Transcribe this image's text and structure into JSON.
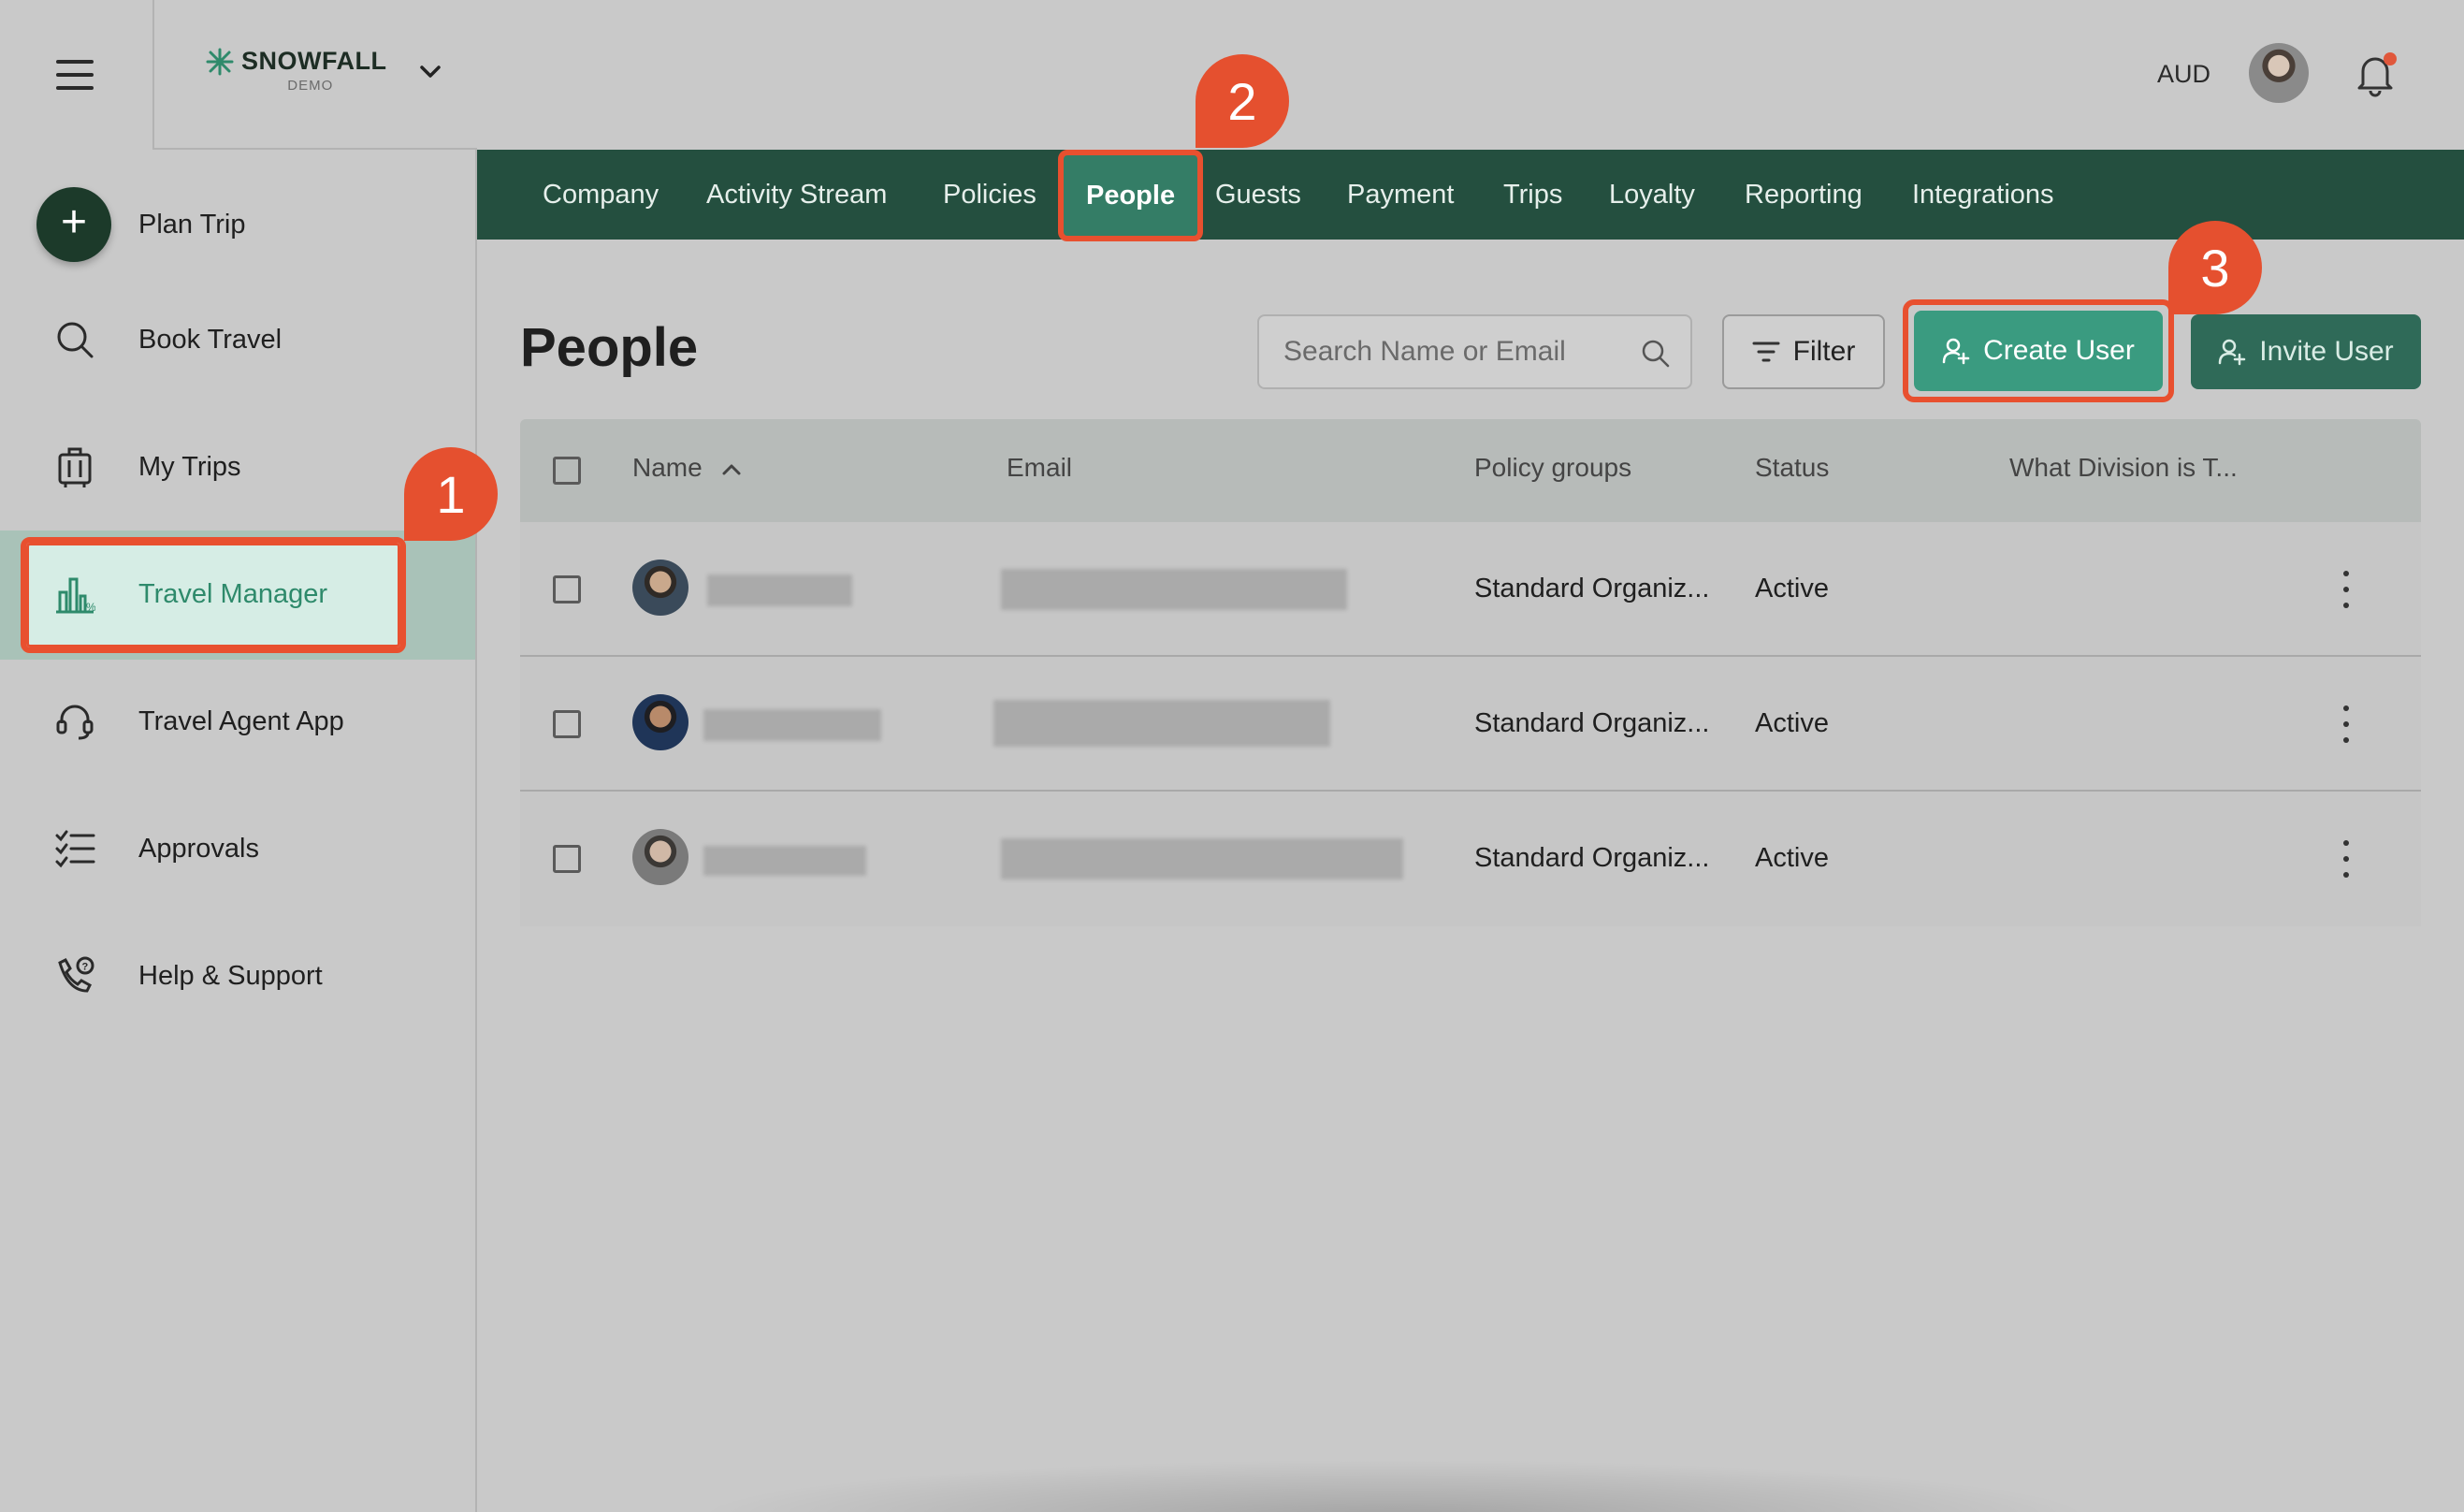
{
  "brand": {
    "name": "SNOWFALL",
    "sub": "DEMO"
  },
  "header": {
    "currency": "AUD"
  },
  "sidebar": {
    "items": [
      {
        "label": "Plan Trip",
        "icon": "plus-icon"
      },
      {
        "label": "Book Travel",
        "icon": "search-icon"
      },
      {
        "label": "My Trips",
        "icon": "luggage-icon"
      },
      {
        "label": "Travel Manager",
        "icon": "chart-icon",
        "active": true
      },
      {
        "label": "Travel Agent App",
        "icon": "headset-icon"
      },
      {
        "label": "Approvals",
        "icon": "checklist-icon"
      },
      {
        "label": "Help & Support",
        "icon": "phone-help-icon"
      }
    ]
  },
  "tabs": [
    "Company",
    "Activity Stream",
    "Policies",
    "People",
    "Guests",
    "Payment",
    "Trips",
    "Loyalty",
    "Reporting",
    "Integrations"
  ],
  "active_tab": "People",
  "page": {
    "title": "People",
    "search_placeholder": "Search Name or Email",
    "filter_label": "Filter",
    "create_label": "Create User",
    "invite_label": "Invite User"
  },
  "table": {
    "columns": {
      "name": "Name",
      "email": "Email",
      "policy": "Policy groups",
      "status": "Status",
      "division": "What Division is T..."
    },
    "rows": [
      {
        "policy": "Standard Organiz...",
        "status": "Active"
      },
      {
        "policy": "Standard Organiz...",
        "status": "Active"
      },
      {
        "policy": "Standard Organiz...",
        "status": "Active"
      }
    ]
  },
  "callouts": [
    "1",
    "2",
    "3"
  ],
  "colors": {
    "accent": "#3a9b80",
    "nav": "#244f3f",
    "callout": "#e5502f",
    "active_text": "#2e8a6b"
  }
}
